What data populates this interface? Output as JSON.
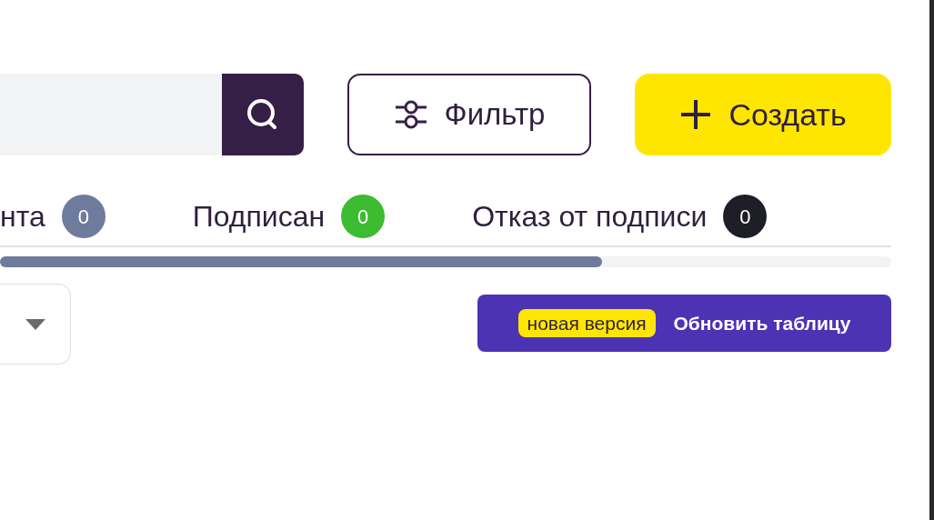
{
  "toolbar": {
    "filter_button": "Фильтр",
    "create_button": "Создать"
  },
  "status_tabs": [
    {
      "label": "нта",
      "count": "0",
      "color": "#6e7b9c"
    },
    {
      "label": "Подписан",
      "count": "0",
      "color": "#3dbb31"
    },
    {
      "label": "Отказ от подписи",
      "count": "0",
      "color": "#1e1e26"
    }
  ],
  "update_banner": {
    "badge": "новая версия",
    "label": "Обновить таблицу"
  }
}
